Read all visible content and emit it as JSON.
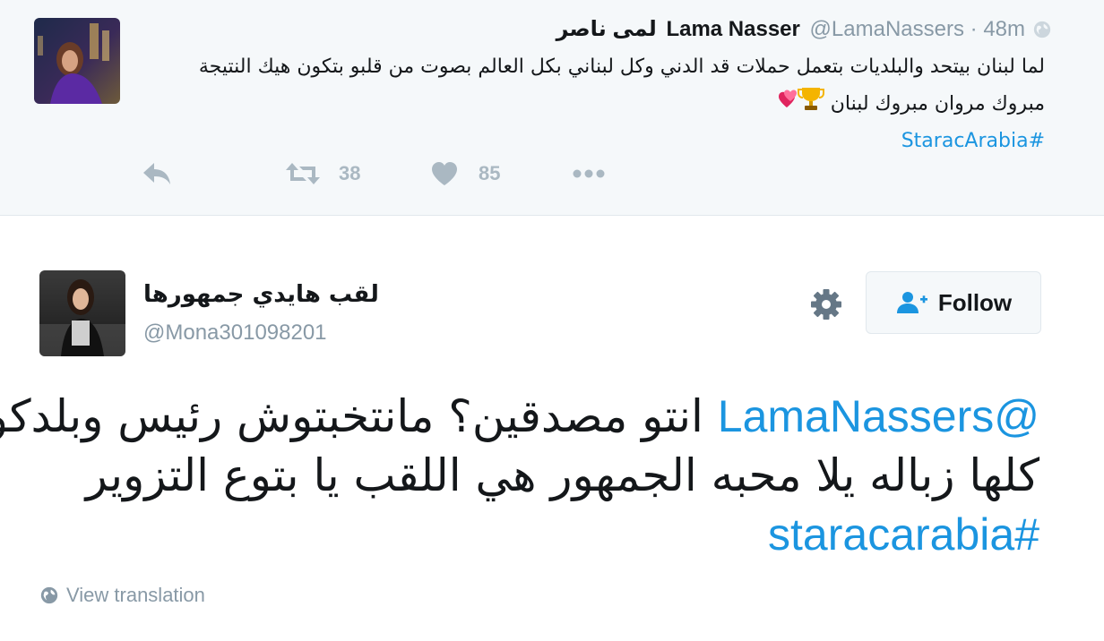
{
  "parent_tweet": {
    "arabic_name": "لمى ناصر",
    "name": "Lama Nasser",
    "handle": "@LamaNassers",
    "separator": "·",
    "time": "48m",
    "lines": [
      "لما لبنان بيتحد والبلديات بتعمل حملات قد الدني وكل لبناني بكل العالم بصوت من قلبو بتكون هيك النتيجة",
      "مبروك مروان مبروك لبنان"
    ],
    "emojis": "💕🏆",
    "hashtag": "#StaracArabia",
    "actions": {
      "reply_icon": "reply-icon",
      "retweet_icon": "retweet-icon",
      "retweet_count": "38",
      "like_icon": "heart-icon",
      "like_count": "85",
      "more_icon": "more-icon"
    }
  },
  "reply_tweet": {
    "name": "لقب هايدي جمهورها",
    "handle": "@Mona301098201",
    "follow_label": "Follow",
    "mention": "@LamaNassers",
    "line1_text": " انتو مصدقين؟ مانتخبتوش رئيس وبلدكو",
    "line2_text": "كلها زباله يلا محبه الجمهور هي اللقب يا بتوع التزوير",
    "hashtag": "#staracarabia",
    "view_translation": "View translation"
  },
  "colors": {
    "link": "#1b95e0",
    "muted": "#8899a6",
    "action_gray": "#aab8c2",
    "parent_bg": "#f5f8fa",
    "heart_emoji": "#e0245e",
    "trophy_emoji": "#f4b400"
  }
}
